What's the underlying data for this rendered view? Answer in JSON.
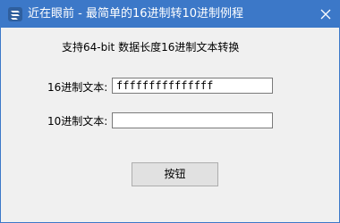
{
  "window": {
    "title": "近在眼前 - 最简单的16进制转10进制例程",
    "icon": "app-icon",
    "close_icon": "close-icon",
    "accent_color": "#3c78c8"
  },
  "content": {
    "heading": "支持64-bit 数据长度16进制文本转换",
    "hex_label": "16进制文本:",
    "hex_value": "fffffffffffffff",
    "dec_label": "10进制文本:",
    "dec_value": "",
    "button_label": "按钮"
  }
}
